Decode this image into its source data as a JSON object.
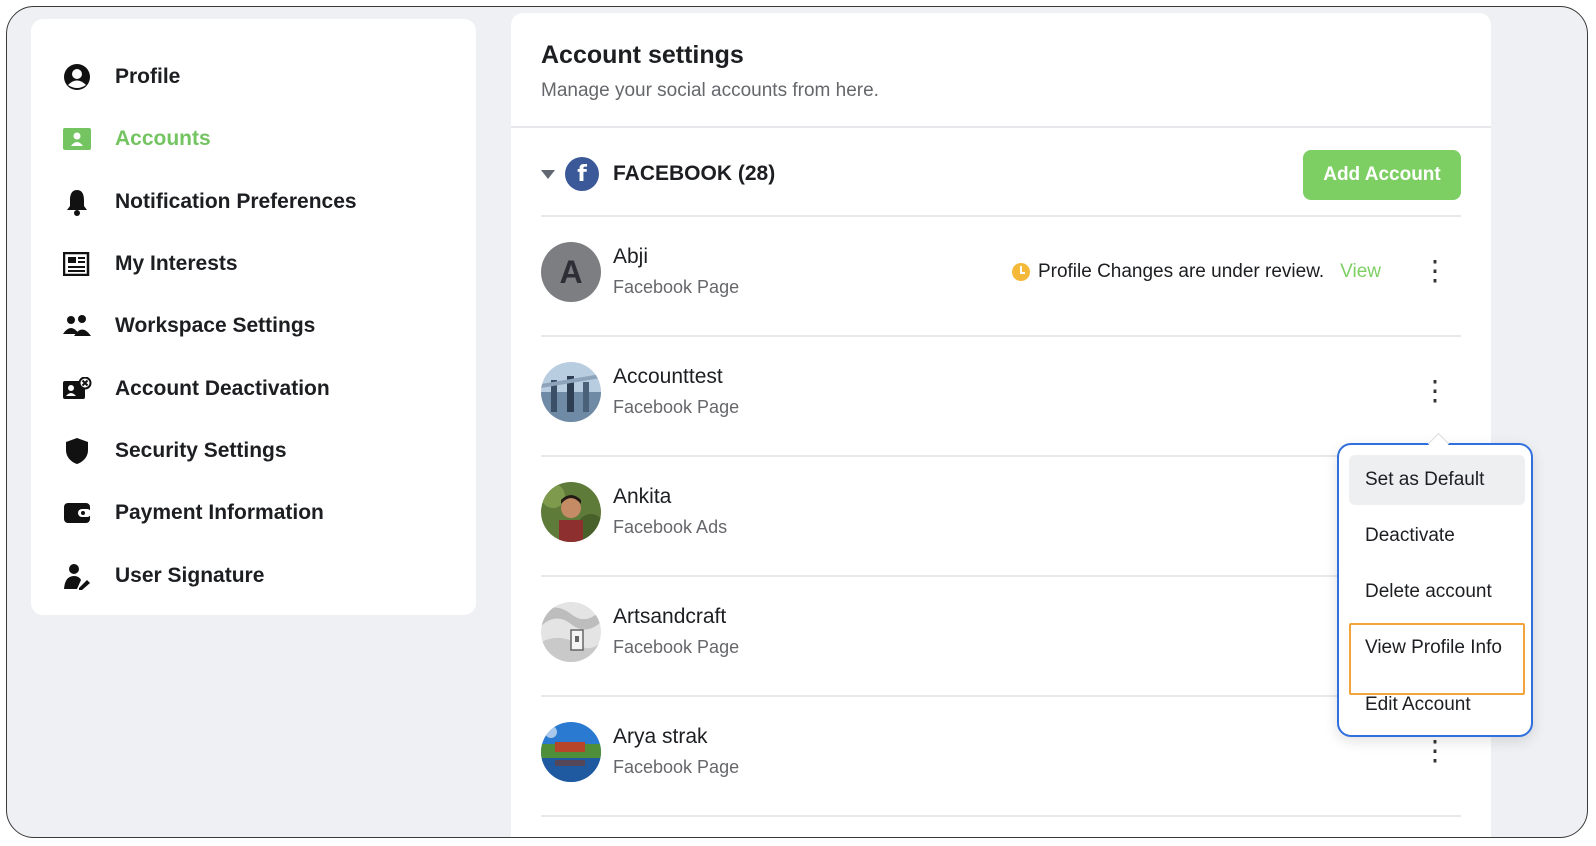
{
  "sidebar": {
    "items": [
      {
        "label": "Profile",
        "icon": "user-circle-icon"
      },
      {
        "label": "Accounts",
        "icon": "id-card-icon",
        "active": true
      },
      {
        "label": "Notification Preferences",
        "icon": "bell-icon"
      },
      {
        "label": "My Interests",
        "icon": "newspaper-icon"
      },
      {
        "label": "Workspace Settings",
        "icon": "users-icon"
      },
      {
        "label": "Account Deactivation",
        "icon": "user-x-icon"
      },
      {
        "label": "Security Settings",
        "icon": "shield-icon"
      },
      {
        "label": "Payment Information",
        "icon": "wallet-icon"
      },
      {
        "label": "User Signature",
        "icon": "user-pen-icon"
      }
    ]
  },
  "main": {
    "title": "Account settings",
    "subtitle": "Manage your social accounts from here.",
    "network": {
      "label": "FACEBOOK (28)",
      "badge": "f"
    },
    "add_button": "Add Account",
    "review_text": "Profile Changes are under review.",
    "view_link": "View",
    "accounts": [
      {
        "name": "Abji",
        "type": "Facebook Page",
        "initial": "A"
      },
      {
        "name": "Accounttest",
        "type": "Facebook Page"
      },
      {
        "name": "Ankita",
        "type": "Facebook Ads"
      },
      {
        "name": "Artsandcraft",
        "type": "Facebook Page"
      },
      {
        "name": "Arya strak",
        "type": "Facebook Page"
      }
    ]
  },
  "dropdown": {
    "items": [
      "Set as Default",
      "Deactivate",
      "Delete account",
      "View Profile Info",
      "Edit Account"
    ]
  },
  "colors": {
    "accent_green": "#7dcf63",
    "facebook_blue": "#3b5998",
    "dropdown_border": "#2f6fde",
    "highlight_orange": "#f2a43a",
    "review_yellow": "#f5b93a"
  }
}
